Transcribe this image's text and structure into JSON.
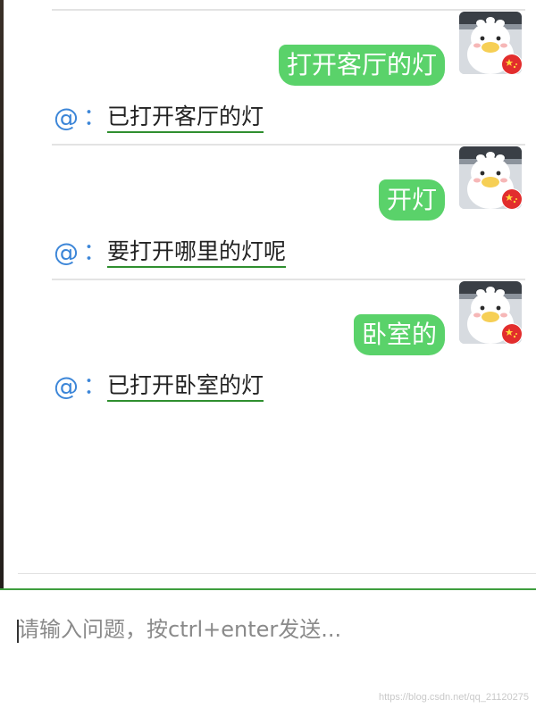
{
  "conversation": [
    {
      "user": "打开客厅的灯",
      "bot_prefix": "@",
      "bot_sep": "：",
      "bot": "已打开客厅的灯"
    },
    {
      "user": "开灯",
      "bot_prefix": "@",
      "bot_sep": "：",
      "bot": "要打开哪里的灯呢"
    },
    {
      "user": "卧室的",
      "bot_prefix": "@",
      "bot_sep": "：",
      "bot": "已打开卧室的灯"
    }
  ],
  "input": {
    "placeholder": "请输入问题，按ctrl+enter发送..."
  },
  "watermark": "https://blog.csdn.net/qq_21120275",
  "colors": {
    "user_bubble": "#5ad26a",
    "bot_prefix": "#3c86d8",
    "reply_underline": "#2f8f2f",
    "input_border": "#3e9e3e"
  },
  "icons": {
    "avatar": "duck-avatar-icon",
    "badge": "flag-badge-icon"
  }
}
